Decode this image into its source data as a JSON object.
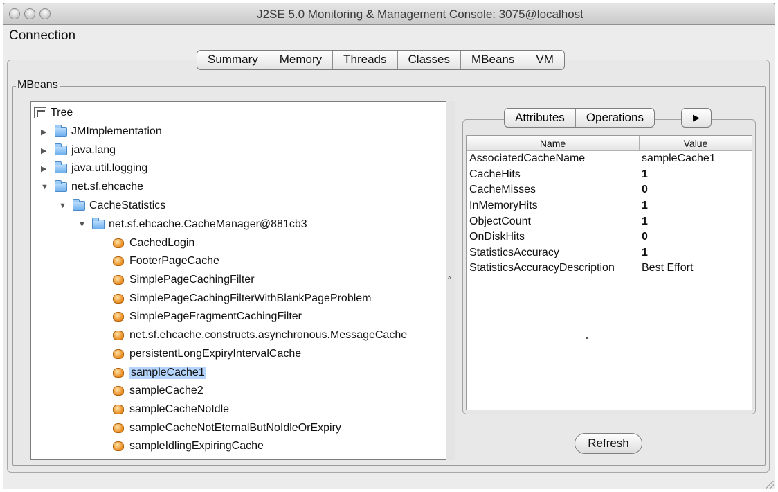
{
  "window": {
    "title": "J2SE 5.0 Monitoring & Management Console: 3075@localhost"
  },
  "menubar": {
    "items": [
      "Connection"
    ]
  },
  "main_tabs": [
    {
      "label": "Summary"
    },
    {
      "label": "Memory"
    },
    {
      "label": "Threads"
    },
    {
      "label": "Classes"
    },
    {
      "label": "MBeans",
      "selected": true
    },
    {
      "label": "VM"
    }
  ],
  "mbeans": {
    "group_label": "MBeans",
    "tree": {
      "root_label": "Tree",
      "items": [
        {
          "label": "JMImplementation",
          "expanded": false
        },
        {
          "label": "java.lang",
          "expanded": false
        },
        {
          "label": "java.util.logging",
          "expanded": false
        },
        {
          "label": "net.sf.ehcache",
          "expanded": true
        },
        {
          "label": "CacheStatistics",
          "expanded": true
        },
        {
          "label": "net.sf.ehcache.CacheManager@881cb3",
          "expanded": true
        },
        {
          "label": "CachedLogin"
        },
        {
          "label": "FooterPageCache"
        },
        {
          "label": "SimplePageCachingFilter"
        },
        {
          "label": "SimplePageCachingFilterWithBlankPageProblem"
        },
        {
          "label": "SimplePageFragmentCachingFilter"
        },
        {
          "label": "net.sf.ehcache.constructs.asynchronous.MessageCache"
        },
        {
          "label": "persistentLongExpiryIntervalCache"
        },
        {
          "label": "sampleCache1",
          "selected": true
        },
        {
          "label": "sampleCache2"
        },
        {
          "label": "sampleCacheNoIdle"
        },
        {
          "label": "sampleCacheNotEternalButNoIdleOrExpiry"
        },
        {
          "label": "sampleIdlingExpiringCache"
        }
      ]
    },
    "detail_tabs": [
      {
        "label": "Attributes",
        "selected": true
      },
      {
        "label": "Operations"
      }
    ],
    "attributes": {
      "columns": [
        "Name",
        "Value"
      ],
      "rows": [
        {
          "name": "AssociatedCacheName",
          "value": "sampleCache1"
        },
        {
          "name": "CacheHits",
          "value": "1"
        },
        {
          "name": "CacheMisses",
          "value": "0"
        },
        {
          "name": "InMemoryHits",
          "value": "1"
        },
        {
          "name": "ObjectCount",
          "value": "1"
        },
        {
          "name": "OnDiskHits",
          "value": "0"
        },
        {
          "name": "StatisticsAccuracy",
          "value": "1"
        },
        {
          "name": "StatisticsAccuracyDescription",
          "value": "Best Effort"
        }
      ]
    },
    "refresh_label": "Refresh"
  },
  "colors": {
    "selection": "#b5d5ff",
    "bean_icon": "#e98a1e",
    "folder_icon": "#6fb0ee"
  },
  "icons": {
    "tree_root": "tree-icon",
    "folder": "folder-icon",
    "mbean": "mbean-icon",
    "more_tabs": "right-arrow-icon"
  }
}
